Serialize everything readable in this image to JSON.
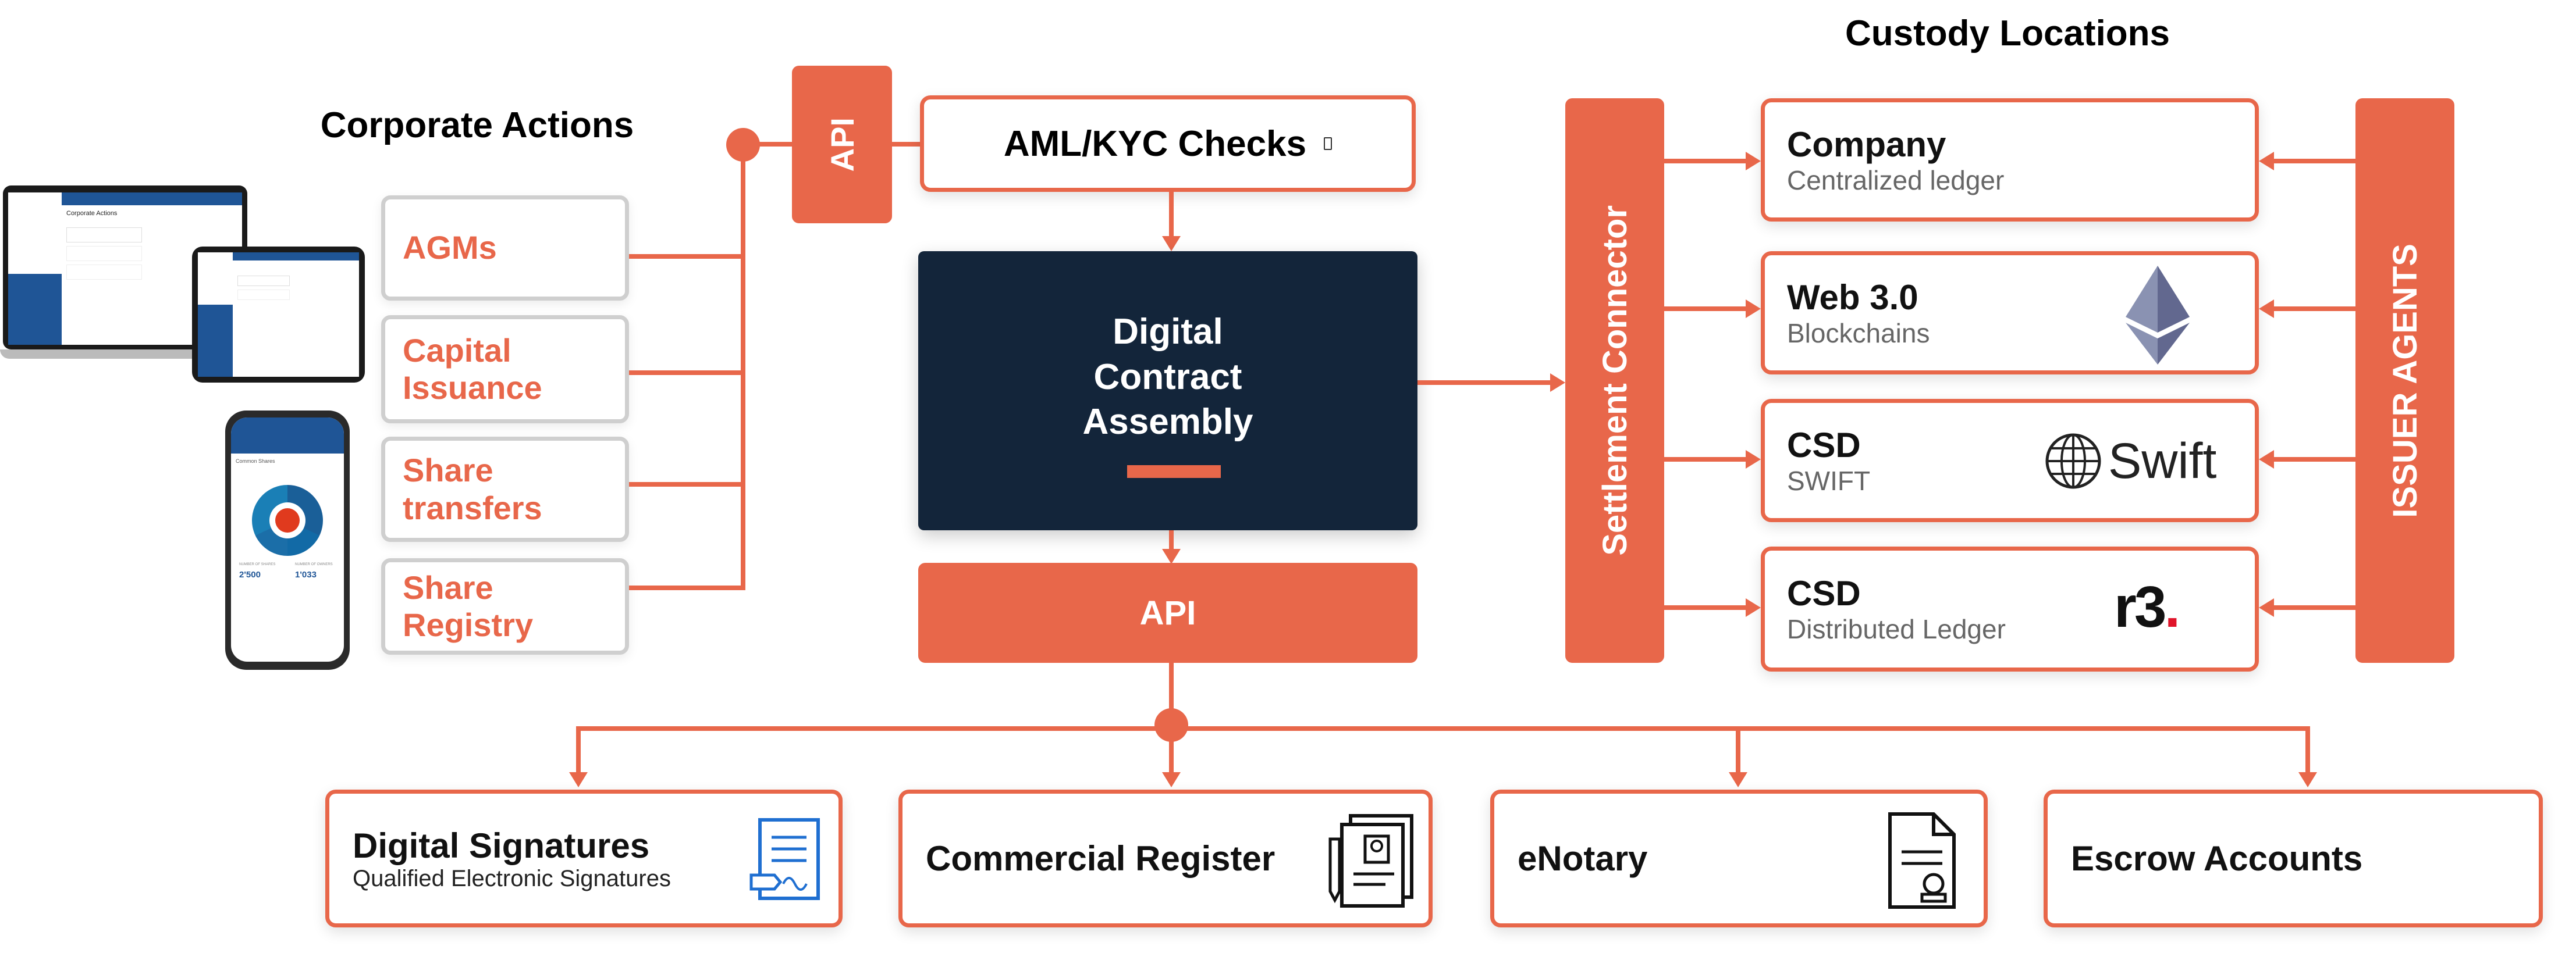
{
  "corporate_actions": {
    "title": "Corporate Actions",
    "items": [
      "AGMs",
      "Capital Issuance",
      "Share transfers",
      "Share Registry"
    ]
  },
  "api_top": "API",
  "aml_kyc": "AML/KYC Checks",
  "core": {
    "title": "Digital Contract Assembly"
  },
  "api_bottom": "API",
  "settlement_connector": "Settlement Connector",
  "issuer_agents": "ISSUER AGENTS",
  "custody": {
    "title": "Custody Locations",
    "items": [
      {
        "main": "Company",
        "sub": "Centralized ledger",
        "logo": "none"
      },
      {
        "main": "Web 3.0",
        "sub": "Blockchains",
        "logo": "ethereum-logo"
      },
      {
        "main": "CSD",
        "sub": "SWIFT",
        "logo": "swift-logo",
        "logo_text": "Swift"
      },
      {
        "main": "CSD",
        "sub": "Distributed Ledger",
        "logo": "r3-logo",
        "logo_text": "r3."
      }
    ]
  },
  "services": [
    {
      "main": "Digital Signatures",
      "sub": "Qualified Electronic Signatures",
      "icon": "signature-document-icon"
    },
    {
      "main": "Commercial Register",
      "icon": "register-document-icon"
    },
    {
      "main": "eNotary",
      "icon": "notary-stamp-document-icon"
    },
    {
      "main": "Escrow Accounts"
    }
  ],
  "devices": {
    "laptop_screen_title": "Corporate Actions",
    "phone_stats": [
      {
        "label": "NUMBER OF SHARES",
        "value": "2'500"
      },
      {
        "label": "NUMBER OF OWNERS",
        "value": "1'033"
      }
    ],
    "phone_dropdown": "Common Shares"
  },
  "colors": {
    "accent": "#e8674a",
    "dark": "#13253a",
    "box_border": "#cfcfcf"
  }
}
